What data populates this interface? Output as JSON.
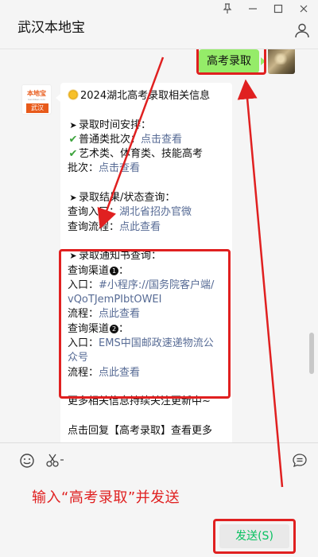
{
  "window": {
    "title": "武汉本地宝",
    "controls": {
      "pin": "⊥",
      "minimize": "—",
      "maximize": "□",
      "close": "✕"
    }
  },
  "sent_message": {
    "text": "高考录取"
  },
  "account_avatar": {
    "top": "本地宝",
    "mid": "bendibao.com",
    "bottom": "武汉"
  },
  "reply": {
    "title": "2024湖北高考录取相关信息",
    "s1_heading": "录取时间安排：",
    "s1_item1_label": "普通类批次：",
    "s1_item1_link": "点击查看",
    "s1_item2_label": "艺术类、体育类、技能高考",
    "s1_item2_cont": "批次：",
    "s1_item2_link": "点击查看",
    "s2_heading": "录取结果/状态查询：",
    "s2_entry_label": "查询入口：",
    "s2_entry_link": "湖北省招办官微",
    "s2_flow_label": "查询流程：",
    "s2_flow_link": "点此查看",
    "s3_heading": "录取通知书查询：",
    "s3_ch1_label": "查询渠道",
    "s3_ch1_num": "1",
    "s3_ch1_entry_label": "入口：",
    "s3_ch1_entry_link": "#小程序://国务院客户端/",
    "s3_ch1_entry_link2": "vQoTJemPIbtOWEI",
    "s3_ch1_flow_label": "流程：",
    "s3_ch1_flow_link": "点此查看",
    "s3_ch2_label": "查询渠道",
    "s3_ch2_num": "2",
    "s3_ch2_entry_label": "入口：",
    "s3_ch2_entry_link": "EMS中国邮政速递物流公",
    "s3_ch2_entry_link2": "众号",
    "s3_ch2_flow_label": "流程：",
    "s3_ch2_flow_link": "点此查看",
    "more": "更多相关信息持续关注更新中~",
    "cut_line": "点击回复【高考录取】查看更多"
  },
  "input_area": {
    "instruction": "输入“高考录取”并发送",
    "send_label": "发送(S)",
    "icons": [
      "emoji-icon",
      "scissors-icon",
      "chat-history-icon"
    ]
  },
  "colors": {
    "highlight": "#e02020",
    "bubble": "#95ec69",
    "link": "#576b95",
    "send_text": "#07c160"
  }
}
